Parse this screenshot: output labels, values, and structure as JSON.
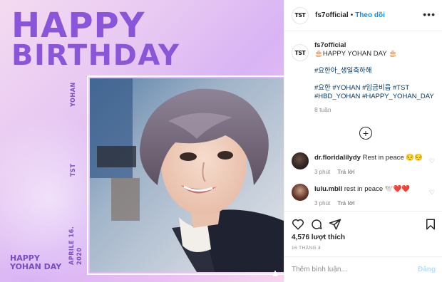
{
  "image": {
    "headline_line1": "HAPPY",
    "headline_line2": "BIRTHDAY",
    "side_name": "YOHAN",
    "side_group": "TST",
    "side_date_line1": "APRILE 16.",
    "side_date_line2": "2020",
    "corner_line1": "HAPPY",
    "corner_line2": "YOHAN DAY",
    "accent_color": "#8a55d8"
  },
  "header": {
    "avatar_text": "TST",
    "username": "fs7official",
    "separator": "•",
    "follow_label": "Theo dõi",
    "more_icon": "more-horizontal-icon"
  },
  "caption": {
    "avatar_text": "TST",
    "username": "fs7official",
    "line1": "🎂HAPPY YOHAN DAY 🎂",
    "line2": "#요한아_생일축하해",
    "line3": "#요한 #YOHAN #임금비읍 #TST",
    "line4": "#HBD_YOHAN #HAPPY_YOHAN_DAY",
    "time": "8 tuần"
  },
  "load_more_icon": "plus-circle-icon",
  "comments": [
    {
      "username": "dr.floridalilydy",
      "text": "Rest in peace 😔😔",
      "time": "3 phút",
      "reply_label": "Trả lời"
    },
    {
      "username": "lulu.mbll",
      "text": "rest in peace 🕊️❤️❤️",
      "time": "3 phút",
      "reply_label": "Trả lời"
    }
  ],
  "actions": {
    "like_icon": "heart-icon",
    "comment_icon": "comment-icon",
    "share_icon": "share-icon",
    "save_icon": "bookmark-icon",
    "likes_text": "4,576 lượt thích",
    "date": "16 THÁNG 4"
  },
  "comment_box": {
    "placeholder": "Thêm bình luận...",
    "post_label": "Đăng"
  }
}
